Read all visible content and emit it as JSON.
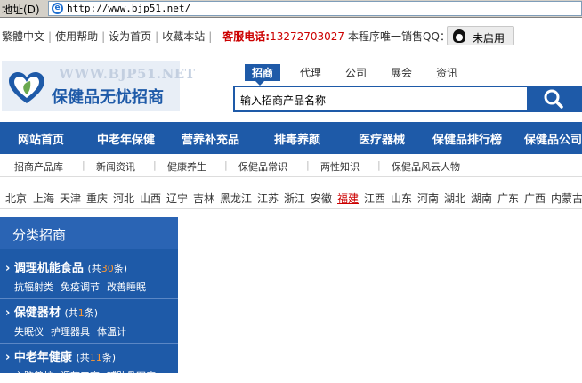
{
  "address_bar": {
    "label": "地址(D)",
    "url": "http://www.bjp51.net/"
  },
  "topbar": {
    "links": [
      "繁體中文",
      "使用帮助",
      "设为首页",
      "收藏本站"
    ],
    "tel_label": "客服电话:",
    "tel_number": "13272703027",
    "qq_note": "本程序唯一销售QQ：",
    "qq_button": "未启用"
  },
  "logo": {
    "www": "WWW.BJP51.NET",
    "name": "保健品无忧招商"
  },
  "search": {
    "tabs": [
      "招商",
      "代理",
      "公司",
      "展会",
      "资讯"
    ],
    "placeholder": "输入招商产品名称"
  },
  "main_nav": [
    "网站首页",
    "中老年保健",
    "营养补充品",
    "排毒养颜",
    "医疗器械",
    "保健品排行榜",
    "保健品公司"
  ],
  "sub_nav": [
    "招商产品库",
    "新闻资讯",
    "健康养生",
    "保健品常识",
    "两性知识",
    "保健品风云人物"
  ],
  "regions": [
    "北京",
    "上海",
    "天津",
    "重庆",
    "河北",
    "山西",
    "辽宁",
    "吉林",
    "黑龙江",
    "江苏",
    "浙江",
    "安徽",
    "福建",
    "江西",
    "山东",
    "河南",
    "湖北",
    "湖南",
    "广东",
    "广西",
    "内蒙古"
  ],
  "highlighted_region": "福建",
  "sidebar": {
    "title": "分类招商",
    "categories": [
      {
        "name": "调理机能食品",
        "count": "30",
        "subs": [
          "抗辐射类",
          "免疫调节",
          "改善睡眠"
        ]
      },
      {
        "name": "保健器材",
        "count": "1",
        "subs": [
          "失眠仪",
          "护理器具",
          "体温计"
        ]
      },
      {
        "name": "中老年健康",
        "count": "11",
        "subs": [
          "心脑养护",
          "调节三高",
          "辅助骨密度"
        ]
      }
    ]
  },
  "colors": {
    "brand_blue": "#1e5aa8",
    "accent_red": "#cc0000",
    "count_orange": "#ff9933"
  }
}
